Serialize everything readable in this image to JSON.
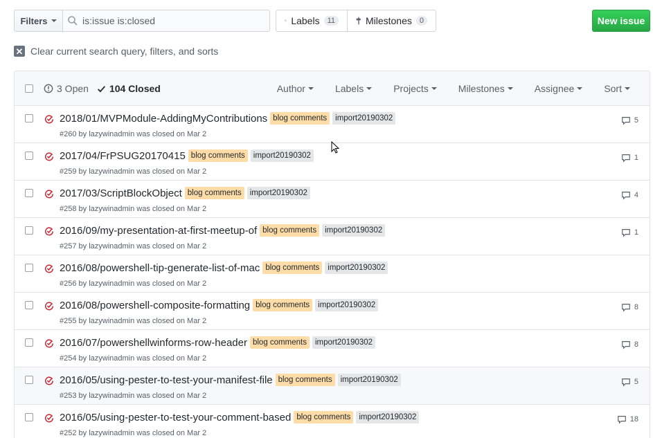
{
  "toolbar": {
    "filters_label": "Filters",
    "search_value": "is:issue is:closed",
    "labels_label": "Labels",
    "labels_count": "11",
    "milestones_label": "Milestones",
    "milestones_count": "0",
    "new_issue_label": "New issue"
  },
  "clear_text": "Clear current search query, filters, and sorts",
  "header": {
    "open_label": "3 Open",
    "closed_label": "104 Closed",
    "menus": [
      "Author",
      "Labels",
      "Projects",
      "Milestones",
      "Assignee",
      "Sort"
    ]
  },
  "labels": {
    "blog": "blog comments",
    "import": "import20190302"
  },
  "issues": [
    {
      "title": "2018/01/MVPModule-AddingMyContributions",
      "meta": "#260 by lazywinadmin was closed on Mar 2",
      "comments": "5"
    },
    {
      "title": "2017/04/FrPSUG20170415",
      "meta": "#259 by lazywinadmin was closed on Mar 2",
      "comments": "1"
    },
    {
      "title": "2017/03/ScriptBlockObject",
      "meta": "#258 by lazywinadmin was closed on Mar 2",
      "comments": "4"
    },
    {
      "title": "2016/09/my-presentation-at-first-meetup-of",
      "meta": "#257 by lazywinadmin was closed on Mar 2",
      "comments": "1"
    },
    {
      "title": "2016/08/powershell-tip-generate-list-of-mac",
      "meta": "#256 by lazywinadmin was closed on Mar 2",
      "comments": ""
    },
    {
      "title": "2016/08/powershell-composite-formatting",
      "meta": "#255 by lazywinadmin was closed on Mar 2",
      "comments": "8"
    },
    {
      "title": "2016/07/powershellwinforms-row-header",
      "meta": "#254 by lazywinadmin was closed on Mar 2",
      "comments": "8"
    },
    {
      "title": "2016/05/using-pester-to-test-your-manifest-file",
      "meta": "#253 by lazywinadmin was closed on Mar 2",
      "comments": "5"
    },
    {
      "title": "2016/05/using-pester-to-test-your-comment-based",
      "meta": "#252 by lazywinadmin was closed on Mar 2",
      "comments": "18"
    }
  ],
  "colors": {
    "closed_icon": "#cb2431",
    "new_issue_bg": "#2ea44f",
    "blog_label_bg": "#fddca8",
    "import_label_bg": "#e4e6e8"
  }
}
